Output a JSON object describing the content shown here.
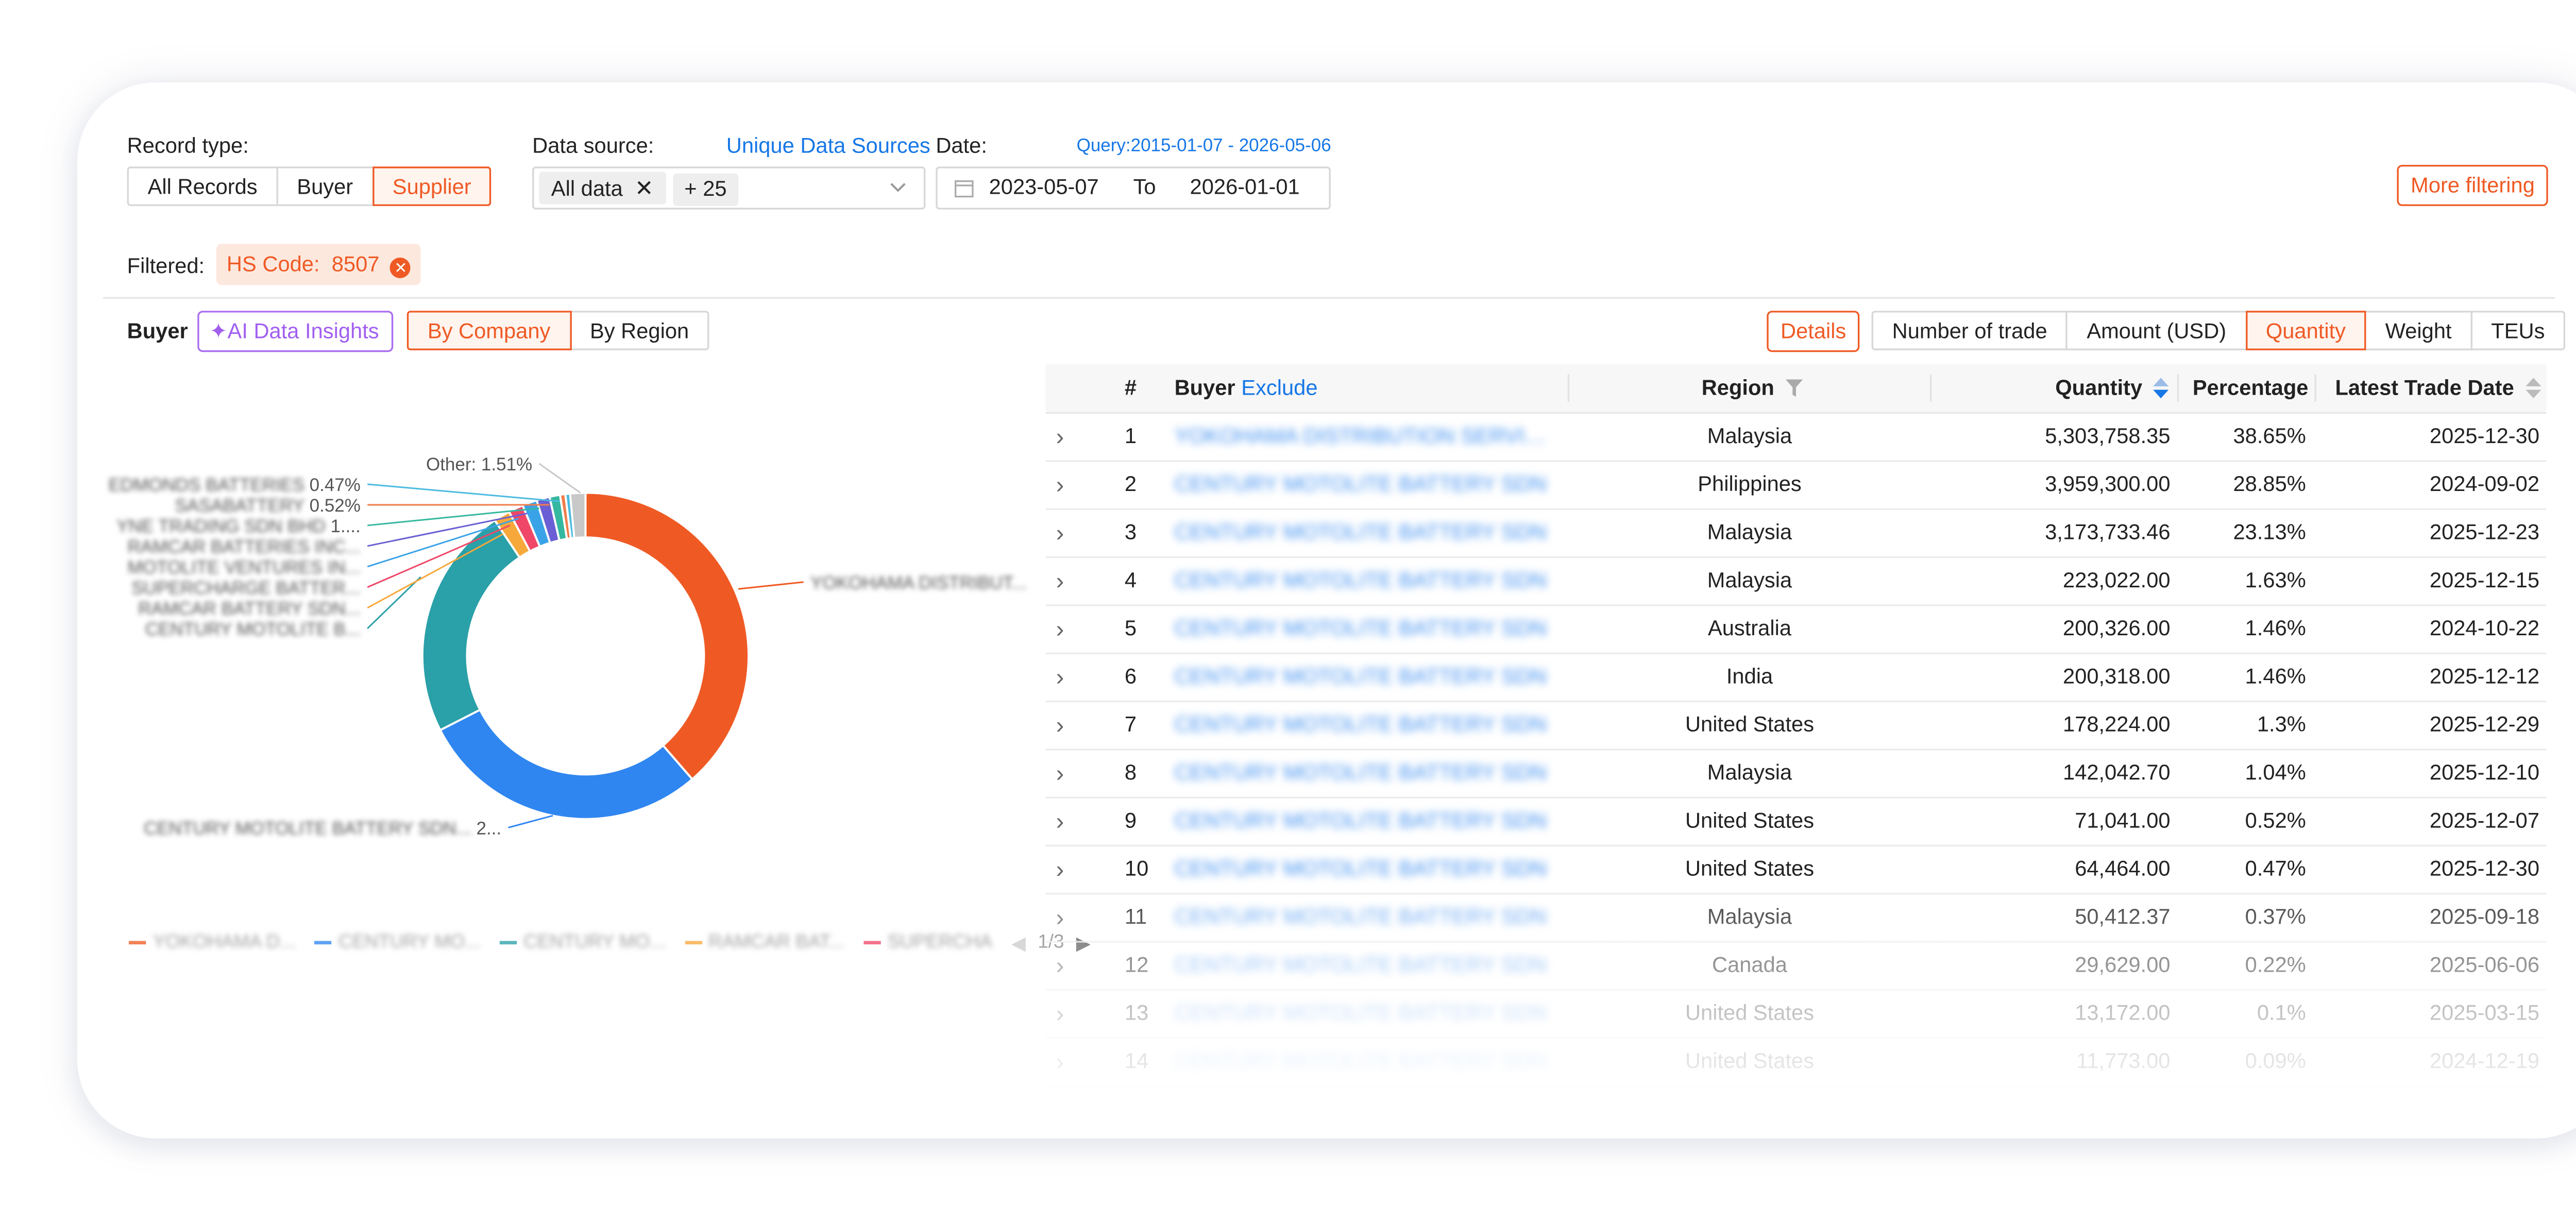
{
  "filters": {
    "record_type_label": "Record type:",
    "record_types": [
      "All Records",
      "Buyer",
      "Supplier"
    ],
    "record_type_active": "Supplier",
    "data_source_label": "Data source:",
    "unique_sources_link": "Unique Data Sources",
    "data_source_chips": [
      "All data",
      "+ 25"
    ],
    "date_label": "Date:",
    "query_range": "Query:2015-01-07 - 2026-05-06",
    "date_from": "2023-05-07",
    "date_to_label": "To",
    "date_to": "2026-01-01",
    "more_filtering": "More filtering",
    "filtered_label": "Filtered:",
    "filtered_tag": "HS Code:",
    "filtered_value": "8507"
  },
  "toolbar": {
    "section_title": "Buyer",
    "ai_insights": "AI Data Insights",
    "group_tabs": [
      "By Company",
      "By Region"
    ],
    "group_active": "By Company",
    "details": "Details",
    "metric_tabs": [
      "Number of trade",
      "Amount (USD)",
      "Quantity",
      "Weight",
      "TEUs"
    ],
    "metric_active": "Quantity"
  },
  "chart_data": {
    "type": "pie",
    "title": "",
    "labels": [
      "YOKOHAMA DISTRIBUT...",
      "CENTURY MOTOLITE BATTERY SDN...",
      "CENTURY MOTOLITE B...",
      "RAMCAR BATTERY SDN...",
      "SUPERCHARGE BATTER...",
      "MOTOLITE VENTURES IN...",
      "RAMCAR BATTERIES INC...",
      "YNE TRADING SDN BHD",
      "SASABATTERY",
      "EDMONDS BATTERIES",
      "Other"
    ],
    "values": [
      38.65,
      28.85,
      23.13,
      1.63,
      1.46,
      1.46,
      1.3,
      1.04,
      0.52,
      0.47,
      1.51
    ],
    "colors": [
      "#ef5a24",
      "#2f86f0",
      "#2aa0a8",
      "#f7a83a",
      "#f04768",
      "#3aa3e8",
      "#6a5fd4",
      "#35b8a0",
      "#f07c4a",
      "#4cbbe0",
      "#c8c8c8"
    ],
    "callouts": [
      {
        "text": "YOKOHAMA DISTRIBUT...",
        "blurred": true
      },
      {
        "text": "CENTURY MOTOLITE BATTERY SDN...",
        "value": "2...",
        "blurred": true
      },
      {
        "text": "CENTURY MOTOLITE B...",
        "blurred": true
      },
      {
        "text": "RAMCAR BATTERY SDN...",
        "blurred": true
      },
      {
        "text": "SUPERCHARGE BATTER...",
        "blurred": true
      },
      {
        "text": "MOTOLITE VENTURES IN...",
        "blurred": true
      },
      {
        "text": "RAMCAR BATTERIES INC...",
        "blurred": true
      },
      {
        "text": "YNE TRADING SDN BHD",
        "value": "1....",
        "blurred": true
      },
      {
        "text": "SASABATTERY",
        "value": "0.52%",
        "blurred": true
      },
      {
        "text": "EDMONDS BATTERIES",
        "value": "0.47%",
        "blurred": true
      },
      {
        "text": "Other:",
        "value": "1.51%",
        "blurred": false
      }
    ],
    "legend": [
      {
        "name": "YOKOHAMA D...",
        "color": "#ef5a24"
      },
      {
        "name": "CENTURY MO...",
        "color": "#2f86f0"
      },
      {
        "name": "CENTURY MO...",
        "color": "#2aa0a8"
      },
      {
        "name": "RAMCAR BAT...",
        "color": "#f7a83a"
      },
      {
        "name": "SUPERCHA",
        "color": "#f04768"
      }
    ],
    "legend_page": "1/3"
  },
  "table": {
    "headers": {
      "index": "#",
      "buyer": "Buyer",
      "exclude": "Exclude",
      "region": "Region",
      "quantity": "Quantity",
      "percentage": "Percentage",
      "date": "Latest Trade Date"
    },
    "rows": [
      {
        "n": "1",
        "buyer": "YOKOHAMA DISTRIBUTION SERVIC...",
        "region": "Malaysia",
        "qty": "5,303,758.35",
        "pct": "38.65%",
        "date": "2025-12-30"
      },
      {
        "n": "2",
        "buyer": "CENTURY MOTOLITE BATTERY SDN",
        "region": "Philippines",
        "qty": "3,959,300.00",
        "pct": "28.85%",
        "date": "2024-09-02"
      },
      {
        "n": "3",
        "buyer": "CENTURY MOTOLITE BATTERY SDN",
        "region": "Malaysia",
        "qty": "3,173,733.46",
        "pct": "23.13%",
        "date": "2025-12-23"
      },
      {
        "n": "4",
        "buyer": "CENTURY MOTOLITE BATTERY SDN",
        "region": "Malaysia",
        "qty": "223,022.00",
        "pct": "1.63%",
        "date": "2025-12-15"
      },
      {
        "n": "5",
        "buyer": "CENTURY MOTOLITE BATTERY SDN",
        "region": "Australia",
        "qty": "200,326.00",
        "pct": "1.46%",
        "date": "2024-10-22"
      },
      {
        "n": "6",
        "buyer": "CENTURY MOTOLITE BATTERY SDN",
        "region": "India",
        "qty": "200,318.00",
        "pct": "1.46%",
        "date": "2025-12-12"
      },
      {
        "n": "7",
        "buyer": "CENTURY MOTOLITE BATTERY SDN",
        "region": "United States",
        "qty": "178,224.00",
        "pct": "1.3%",
        "date": "2025-12-29"
      },
      {
        "n": "8",
        "buyer": "CENTURY MOTOLITE BATTERY SDN",
        "region": "Malaysia",
        "qty": "142,042.70",
        "pct": "1.04%",
        "date": "2025-12-10"
      },
      {
        "n": "9",
        "buyer": "CENTURY MOTOLITE BATTERY SDN",
        "region": "United States",
        "qty": "71,041.00",
        "pct": "0.52%",
        "date": "2025-12-07"
      },
      {
        "n": "10",
        "buyer": "CENTURY MOTOLITE BATTERY SDN",
        "region": "United States",
        "qty": "64,464.00",
        "pct": "0.47%",
        "date": "2025-12-30"
      },
      {
        "n": "11",
        "buyer": "CENTURY MOTOLITE BATTERY SDN",
        "region": "Malaysia",
        "qty": "50,412.37",
        "pct": "0.37%",
        "date": "2025-09-18"
      },
      {
        "n": "12",
        "buyer": "CENTURY MOTOLITE BATTERY SDN",
        "region": "Canada",
        "qty": "29,629.00",
        "pct": "0.22%",
        "date": "2025-06-06"
      },
      {
        "n": "13",
        "buyer": "CENTURY MOTOLITE BATTERY SDN",
        "region": "United States",
        "qty": "13,172.00",
        "pct": "0.1%",
        "date": "2025-03-15"
      },
      {
        "n": "14",
        "buyer": "CENTURY MOTOLITE BATTERY SDN",
        "region": "United States",
        "qty": "11,773.00",
        "pct": "0.09%",
        "date": "2024-12-19"
      }
    ]
  }
}
